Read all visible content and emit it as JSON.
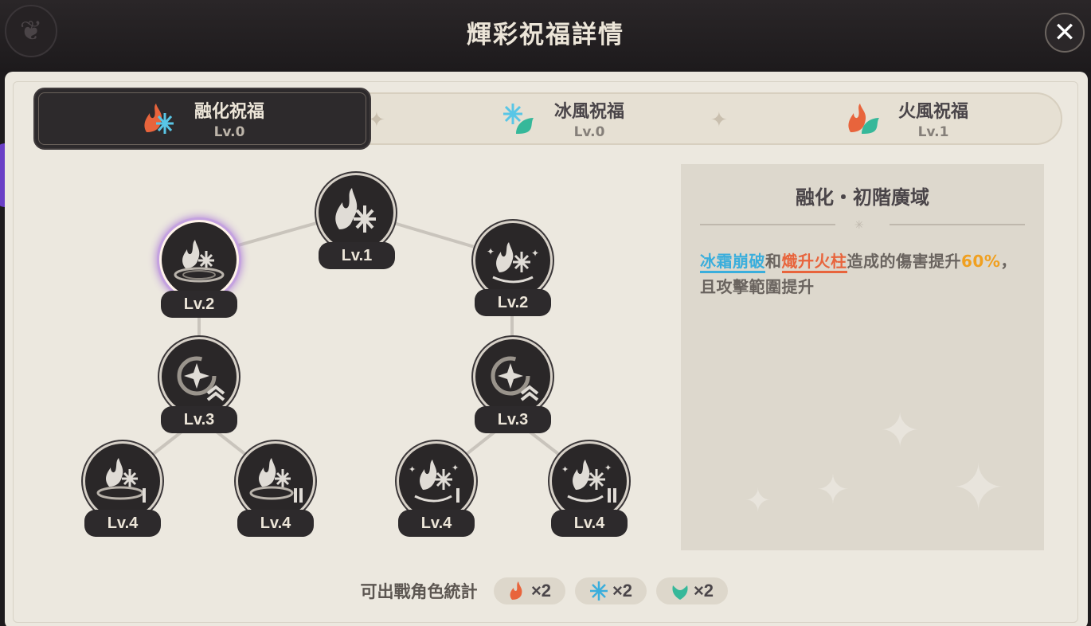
{
  "header": {
    "title": "輝彩祝福詳情",
    "close_symbol": "✕"
  },
  "tabs": [
    {
      "name": "融化祝福",
      "level": "Lv.0",
      "icon": "pyro-cryo-icon",
      "active": true
    },
    {
      "name": "冰風祝福",
      "level": "Lv.0",
      "icon": "cryo-anemo-icon",
      "active": false
    },
    {
      "name": "火風祝福",
      "level": "Lv.1",
      "icon": "pyro-anemo-icon",
      "active": false
    }
  ],
  "tree": {
    "root": {
      "level": "Lv.1"
    },
    "left_branch": {
      "tier2": "Lv.2",
      "tier3": "Lv.3",
      "tier4a": "Lv.4",
      "tier4b": "Lv.4"
    },
    "right_branch": {
      "tier2": "Lv.2",
      "tier3": "Lv.3",
      "tier4a": "Lv.4",
      "tier4b": "Lv.4"
    },
    "selected": "left-tier2"
  },
  "detail": {
    "title": "融化・初階廣域",
    "keyword_cryo": "冰霜崩破",
    "connector": "和",
    "keyword_pyro": "熾升火柱",
    "text_mid": "造成的傷害提升",
    "value": "60%",
    "text_end": "，且攻擊範圍提升"
  },
  "footer": {
    "label": "可出戰角色統計",
    "counts": [
      {
        "element": "pyro",
        "icon": "pyro-icon",
        "count": "×2"
      },
      {
        "element": "cryo",
        "icon": "cryo-icon",
        "count": "×2"
      },
      {
        "element": "anemo",
        "icon": "anemo-icon",
        "count": "×2"
      }
    ]
  },
  "colors": {
    "pyro": "#e8643c",
    "cryo": "#3aaedc",
    "anemo": "#36b89a",
    "highlight_value": "#f0a020",
    "selection_glow": "#b58ad9"
  }
}
